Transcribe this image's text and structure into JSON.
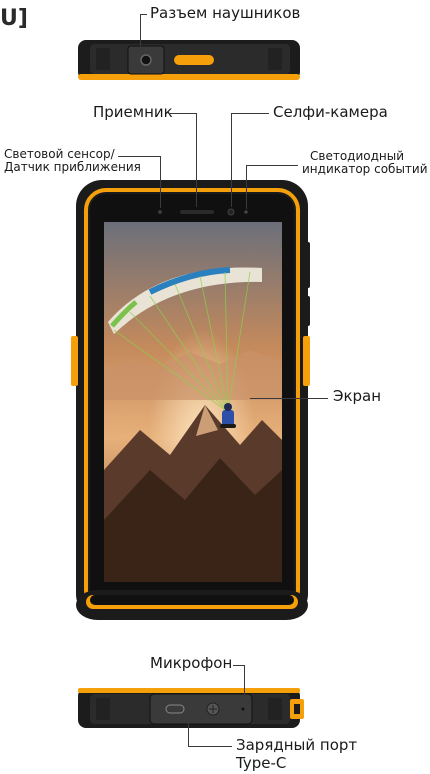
{
  "corner_fragment": "U]",
  "labels": {
    "headphone_jack": "Разъем наушников",
    "receiver": "Приемник",
    "selfie_camera": "Селфи-камера",
    "light_sensor_line1": "Световой сенсор/",
    "light_sensor_line2": "Датчик приближения",
    "led_line1": "Светодиодный",
    "led_line2": "индикатор событий",
    "screen": "Экран",
    "microphone": "Микрофон",
    "charging_port_line1": "Зарядный порт",
    "charging_port_line2": "Type-C"
  },
  "colors": {
    "accent": "#f5a00a",
    "body": "#1b1b1b",
    "label_text": "#1a1a1a"
  }
}
